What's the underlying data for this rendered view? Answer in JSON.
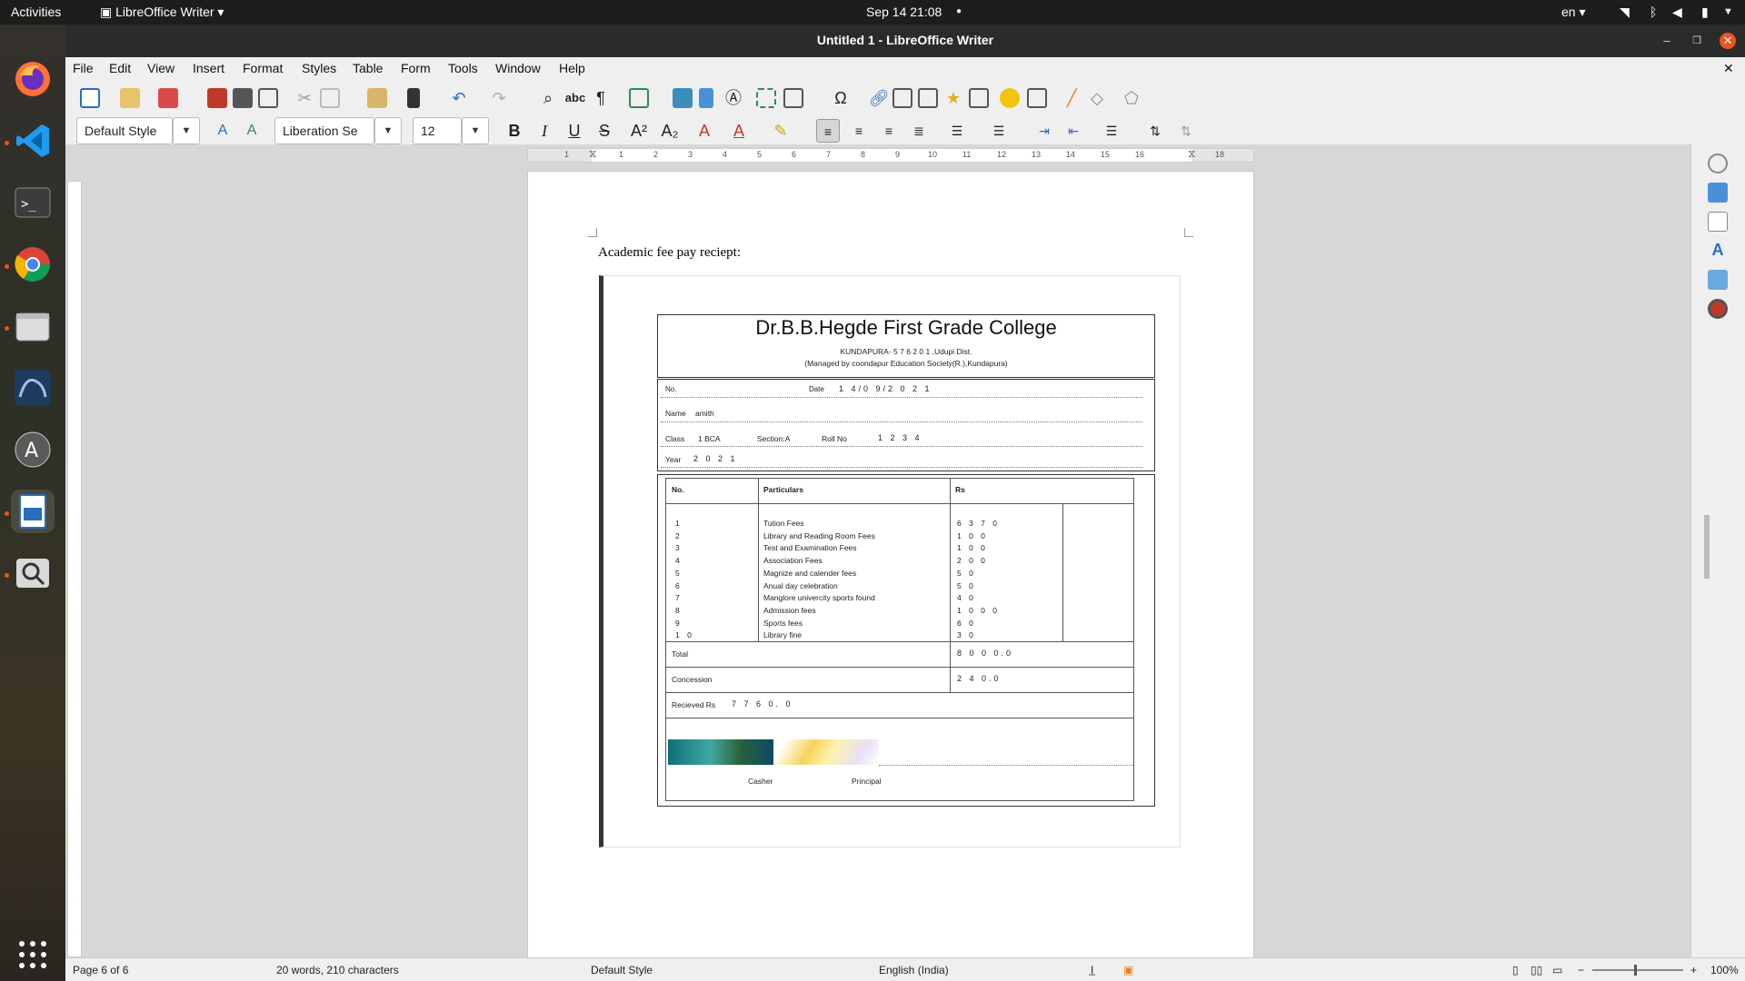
{
  "topbar": {
    "activities": "Activities",
    "app_menu": "LibreOffice Writer",
    "datetime": "Sep 14  21:08",
    "input_lang": "en"
  },
  "dock": {
    "apps": [
      "firefox-icon",
      "vscode-icon",
      "terminal-icon",
      "chrome-icon",
      "files-icon",
      "mysql-workbench-icon",
      "software-updater-icon",
      "writer-icon",
      "magnifier-icon",
      "show-apps-icon"
    ]
  },
  "window": {
    "title": "Untitled 1 - LibreOffice Writer"
  },
  "menubar": [
    "File",
    "Edit",
    "View",
    "Insert",
    "Format",
    "Styles",
    "Table",
    "Form",
    "Tools",
    "Window",
    "Help"
  ],
  "format_toolbar": {
    "paragraph_style": "Default Style",
    "font_name": "Liberation Se",
    "font_size": "12"
  },
  "ruler": {
    "marks": [
      "1",
      "1",
      "2",
      "3",
      "4",
      "5",
      "6",
      "7",
      "8",
      "9",
      "10",
      "11",
      "12",
      "13",
      "14",
      "15",
      "16",
      "18"
    ]
  },
  "document": {
    "heading": "Academic fee pay reciept:"
  },
  "receipt": {
    "college_name": "Dr.B.B.Hegde First Grade College",
    "address": "KUNDAPURA- 5 7 6 2 0 1 ,Udupi Dist.",
    "managed_by": "(Managed by coondapur Education Society(R.),Kundapura)",
    "no_label": "No.",
    "date_label": "Date",
    "date_value": "1 4/0 9/2 0 2 1",
    "name_label": "Name",
    "name_value": "amith",
    "class_label": "Class",
    "class_value": "1 BCA",
    "section": "Section:A",
    "roll_label": "Roll No",
    "roll_value": "1 2 3 4",
    "year_label": "Year",
    "year_value": "2 0 2 1",
    "headers": {
      "no": "No.",
      "particulars": "Particulars",
      "rs": "Rs"
    },
    "items": [
      {
        "no": "1",
        "particular": "Tution Fees",
        "rs": "6 3 7 0"
      },
      {
        "no": "2",
        "particular": "Library and Reading Room Fees",
        "rs": "1 0 0"
      },
      {
        "no": "3",
        "particular": "Test and Examination Fees",
        "rs": "1 0 0"
      },
      {
        "no": "4",
        "particular": "Association Fees",
        "rs": "2 0 0"
      },
      {
        "no": "5",
        "particular": "Magnize and calender fees",
        "rs": "5 0"
      },
      {
        "no": "6",
        "particular": "Anual day celebration",
        "rs": "5 0"
      },
      {
        "no": "7",
        "particular": "Manglore univercity sports found",
        "rs": "4 0"
      },
      {
        "no": "8",
        "particular": "Admission fees",
        "rs": "1 0 0 0"
      },
      {
        "no": "9",
        "particular": "Sports fees",
        "rs": "6 0"
      },
      {
        "no": "1 0",
        "particular": "Library fine",
        "rs": "3 0"
      }
    ],
    "total_label": "Total",
    "total_value": "8 0 0 0.0",
    "concession_label": "Concession",
    "concession_value": "2 4 0.0",
    "received_label": "Recieved Rs",
    "received_value": "7 7 6 0. 0",
    "casher": "Casher",
    "principal": "Principal"
  },
  "statusbar": {
    "page": "Page 6 of 6",
    "words": "20 words, 210 characters",
    "style": "Default Style",
    "language": "English (India)",
    "zoom": "100%"
  },
  "colors": {
    "accent": "#e95420",
    "titlebar": "#2b2b2b",
    "close": "#e95420"
  }
}
